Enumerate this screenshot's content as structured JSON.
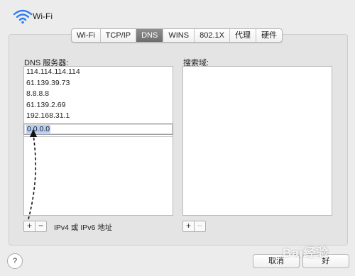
{
  "window": {
    "title": "Wi-Fi"
  },
  "tabs": [
    {
      "label": "Wi-Fi",
      "active": false
    },
    {
      "label": "TCP/IP",
      "active": false
    },
    {
      "label": "DNS",
      "active": true
    },
    {
      "label": "WINS",
      "active": false
    },
    {
      "label": "802.1X",
      "active": false
    },
    {
      "label": "代理",
      "active": false
    },
    {
      "label": "硬件",
      "active": false
    }
  ],
  "dns": {
    "label": "DNS 服务器:",
    "servers": [
      "114.114.114.114",
      "61.139.39.73",
      "8.8.8.8",
      "61.139.2.69",
      "192.168.31.1"
    ],
    "editing_value": "0.0.0.0",
    "hint": "IPv4 或 IPv6 地址",
    "add_label": "+",
    "remove_label": "−"
  },
  "search_domains": {
    "label": "搜索域:",
    "add_label": "+",
    "remove_label": "−"
  },
  "footer": {
    "help_label": "?",
    "cancel_label": "取消",
    "ok_label": "好"
  },
  "watermark": {
    "text": "Bai经验"
  },
  "colors": {
    "background": "#ececec",
    "active_tab": "#7a7a7a",
    "selection": "#b7cff6"
  },
  "icons": {
    "window_icon": "wifi-icon",
    "annotation": "dashed-arrow-icon"
  }
}
